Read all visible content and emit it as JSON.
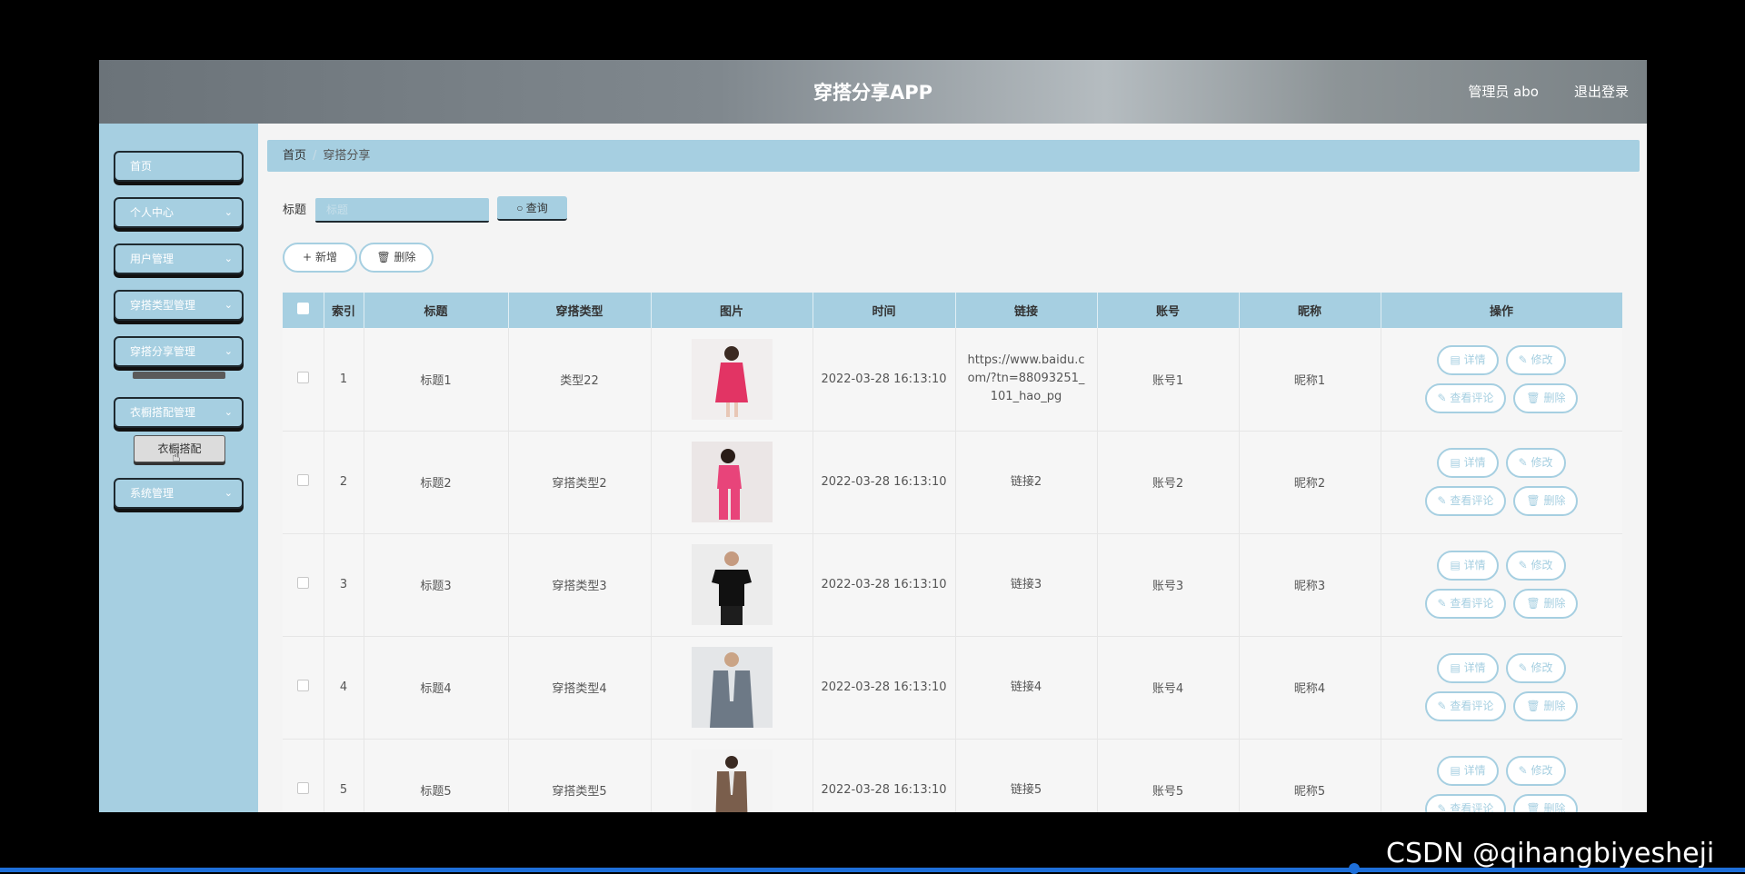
{
  "header": {
    "title": "穿搭分享APP",
    "user": "管理员 abo",
    "logout": "退出登录"
  },
  "sidebar": {
    "items": [
      {
        "label": "首页",
        "chevron": false
      },
      {
        "label": "个人中心",
        "chevron": true
      },
      {
        "label": "用户管理",
        "chevron": true
      },
      {
        "label": "穿搭类型管理",
        "chevron": true
      },
      {
        "label": "穿搭分享管理",
        "chevron": true
      },
      {
        "label": "衣橱搭配管理",
        "chevron": true
      },
      {
        "label": "系统管理",
        "chevron": true
      }
    ],
    "submenu_label": "衣橱搭配"
  },
  "breadcrumb": {
    "home": "首页",
    "current": "穿搭分享"
  },
  "search": {
    "label": "标题",
    "placeholder": "标题",
    "button": "查询"
  },
  "toolbar": {
    "add": "新增",
    "delete": "删除"
  },
  "table": {
    "columns": [
      "索引",
      "标题",
      "穿搭类型",
      "图片",
      "时间",
      "链接",
      "账号",
      "昵称",
      "操作"
    ],
    "rows": [
      {
        "index": "1",
        "title": "标题1",
        "type": "类型22",
        "image": "red-dress",
        "time": "2022-03-28 16:13:10",
        "link": "https://www.baidu.com/?tn=88093251_101_hao_pg",
        "account": "账号1",
        "nickname": "昵称1"
      },
      {
        "index": "2",
        "title": "标题2",
        "type": "穿搭类型2",
        "image": "pink-outfit",
        "time": "2022-03-28 16:13:10",
        "link": "链接2",
        "account": "账号2",
        "nickname": "昵称2"
      },
      {
        "index": "3",
        "title": "标题3",
        "type": "穿搭类型3",
        "image": "black-tshirt",
        "time": "2022-03-28 16:13:10",
        "link": "链接3",
        "account": "账号3",
        "nickname": "昵称3"
      },
      {
        "index": "4",
        "title": "标题4",
        "type": "穿搭类型4",
        "image": "grey-blazer",
        "time": "2022-03-28 16:13:10",
        "link": "链接4",
        "account": "账号4",
        "nickname": "昵称4"
      },
      {
        "index": "5",
        "title": "标题5",
        "type": "穿搭类型5",
        "image": "brown-suit",
        "time": "2022-03-28 16:13:10",
        "link": "链接5",
        "account": "账号5",
        "nickname": "昵称5"
      }
    ],
    "ops": {
      "detail": "详情",
      "edit": "修改",
      "comments": "查看评论",
      "delete": "删除"
    }
  },
  "watermark": "CSDN @qihangbiyesheji",
  "colors": {
    "accent": "#a6cfe1",
    "topbar": "#7a8286"
  }
}
